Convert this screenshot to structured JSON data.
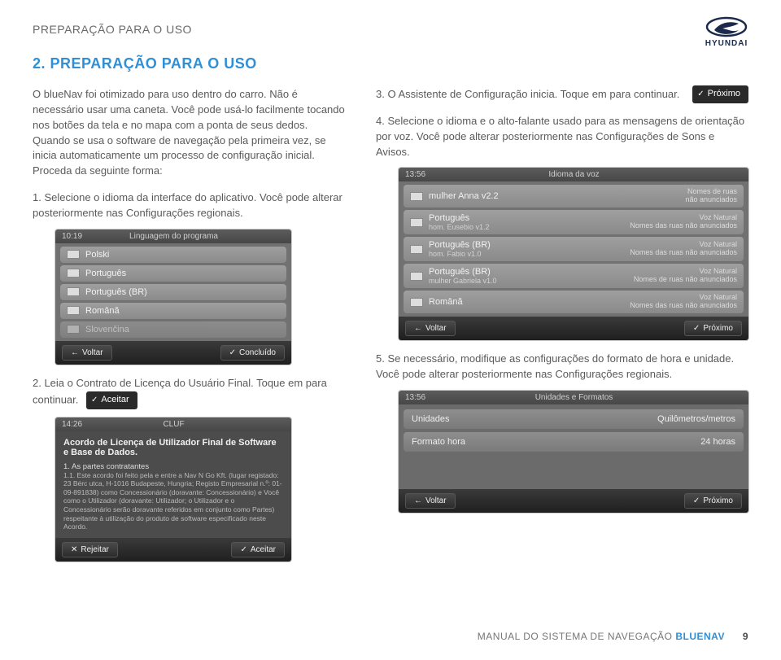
{
  "header": {
    "running_head": "PREPARAÇÃO PARA O USO",
    "brand": "HYUNDAI"
  },
  "section": {
    "title": "2. PREPARAÇÃO PARA O USO"
  },
  "left": {
    "intro": "O blueNav foi otimizado para uso dentro do carro. Não é necessário usar uma caneta. Você pode usá-lo facilmente tocando nos botões da tela e no mapa com a ponta de seus dedos. Quando se usa o software de navegação pela primeira vez, se inicia automaticamente um processo de configuração inicial. Proceda da seguinte forma:",
    "step1": "1. Selecione o idioma da interface do aplicativo. Você pode alterar posteriormente nas Configurações regionais.",
    "step2": "2. Leia o Contrato de Licença do Usuário Final. Toque em              para continuar.",
    "accept_btn": "Aceitar"
  },
  "right": {
    "step3": "3. O Assistente de Configuração inicia. Toque em              para continuar.",
    "next_btn": "Próximo",
    "step4": "4. Selecione o idioma e o alto-falante usado para as mensagens de orientação por voz. Você pode alterar posteriormente nas Configurações de Sons e Avisos.",
    "step5": "5. Se necessário, modifique as configurações do formato de hora e unidade. Você pode alterar posteriormente nas Configurações regionais."
  },
  "device1": {
    "time": "10:19",
    "title": "Linguagem do programa",
    "items": [
      {
        "label": "Polski"
      },
      {
        "label": "Português"
      },
      {
        "label": "Português (BR)"
      },
      {
        "label": "Română"
      },
      {
        "label": "Slovenčina"
      }
    ],
    "back": "Voltar",
    "done": "Concluído"
  },
  "device2": {
    "time": "14:26",
    "title": "CLUF",
    "heading": "Acordo de Licença de Utilizador Final de Software e Base de Dados.",
    "body_lead": "1. As partes contratantes",
    "body_fine": "1.1. Este acordo foi feito pela e entre a Nav N Go Kft. (lugar registado: 23 Bérc utca, H-1016 Budapeste, Hungria; Registo Empresarial n.º: 01-09-891838) como Concessionário (doravante: Concessionário) e Você como o Utilizador (doravante: Utilizador; o Utilizador e o Concessionário serão doravante referidos em conjunto como Partes) respeitante à utilização do produto de software especificado neste Acordo.",
    "reject": "Rejeitar",
    "accept": "Aceitar"
  },
  "device3": {
    "time": "13:56",
    "title": "Idioma da voz",
    "items": [
      {
        "main": "mulher Anna v2.2",
        "sub": "",
        "right1": "Nomes de ruas",
        "right2": "não anunciados"
      },
      {
        "main": "Português",
        "sub": "hom. Eusebio v1.2",
        "right1": "Voz Natural",
        "right2": "Nomes das ruas não anunciados"
      },
      {
        "main": "Português (BR)",
        "sub": "hom. Fabio v1.0",
        "right1": "Voz Natural",
        "right2": "Nomes das ruas não anunciados"
      },
      {
        "main": "Português (BR)",
        "sub": "mulher Gabriela v1.0",
        "right1": "Voz Natural",
        "right2": "Nomes de ruas não anunciados"
      },
      {
        "main": "Română",
        "sub": "",
        "right1": "Voz Natural",
        "right2": "Nomes das ruas não anunciados"
      }
    ],
    "back": "Voltar",
    "next": "Próximo"
  },
  "device4": {
    "time": "13:56",
    "title": "Unidades e Formatos",
    "rows": [
      {
        "k": "Unidades",
        "v": "Quilômetros/metros"
      },
      {
        "k": "Formato hora",
        "v": "24 horas"
      }
    ],
    "back": "Voltar",
    "next": "Próximo"
  },
  "footer": {
    "text_a": "MANUAL DO SISTEMA DE NAVEGAÇÃO ",
    "text_b": "BLUENAV",
    "page": "9"
  }
}
